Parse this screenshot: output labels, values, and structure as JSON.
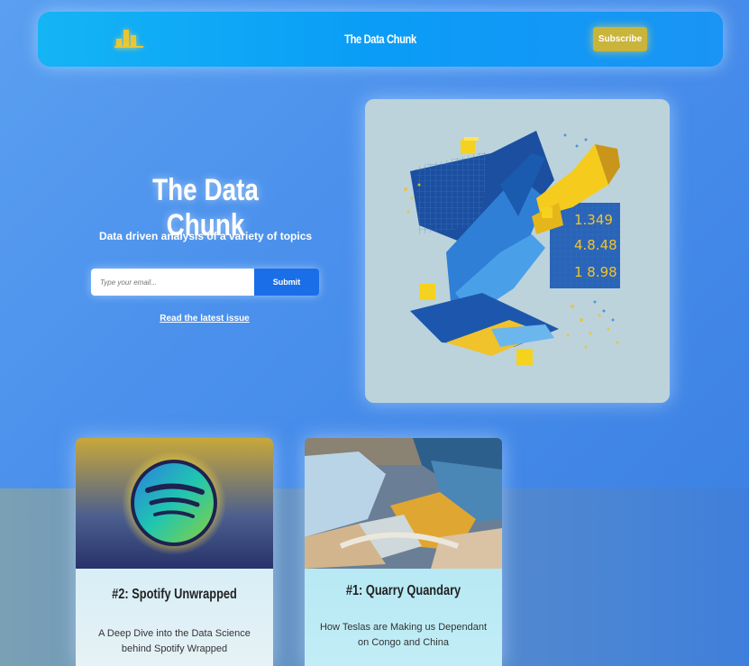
{
  "nav": {
    "title": "The Data Chunk",
    "subscribe_label": "Subscribe",
    "logo_icon": "bar-chart-icon"
  },
  "hero": {
    "title": "The Data Chunk",
    "subtitle": "Data driven analysis of a variety of topics",
    "email_placeholder": "Type your email...",
    "submit_label": "Submit",
    "latest_link": "Read the latest issue",
    "image": {
      "figures": [
        "1.349",
        "4.8.48",
        "1 8.98"
      ]
    }
  },
  "cards": [
    {
      "title": "#2: Spotify Unwrapped",
      "description": "A Deep Dive into the Data Science behind Spotify Wrapped",
      "image_icon": "spotify-logo-icon"
    },
    {
      "title": "#1: Quarry Quandary",
      "description": "How Teslas are Making us Dependant on Congo and China",
      "image_icon": "quarry-landscape-image"
    }
  ],
  "colors": {
    "accent_yellow": "#c9b43c",
    "submit_blue": "#1a6fe8",
    "nav_blue": "#0a9cf6"
  }
}
